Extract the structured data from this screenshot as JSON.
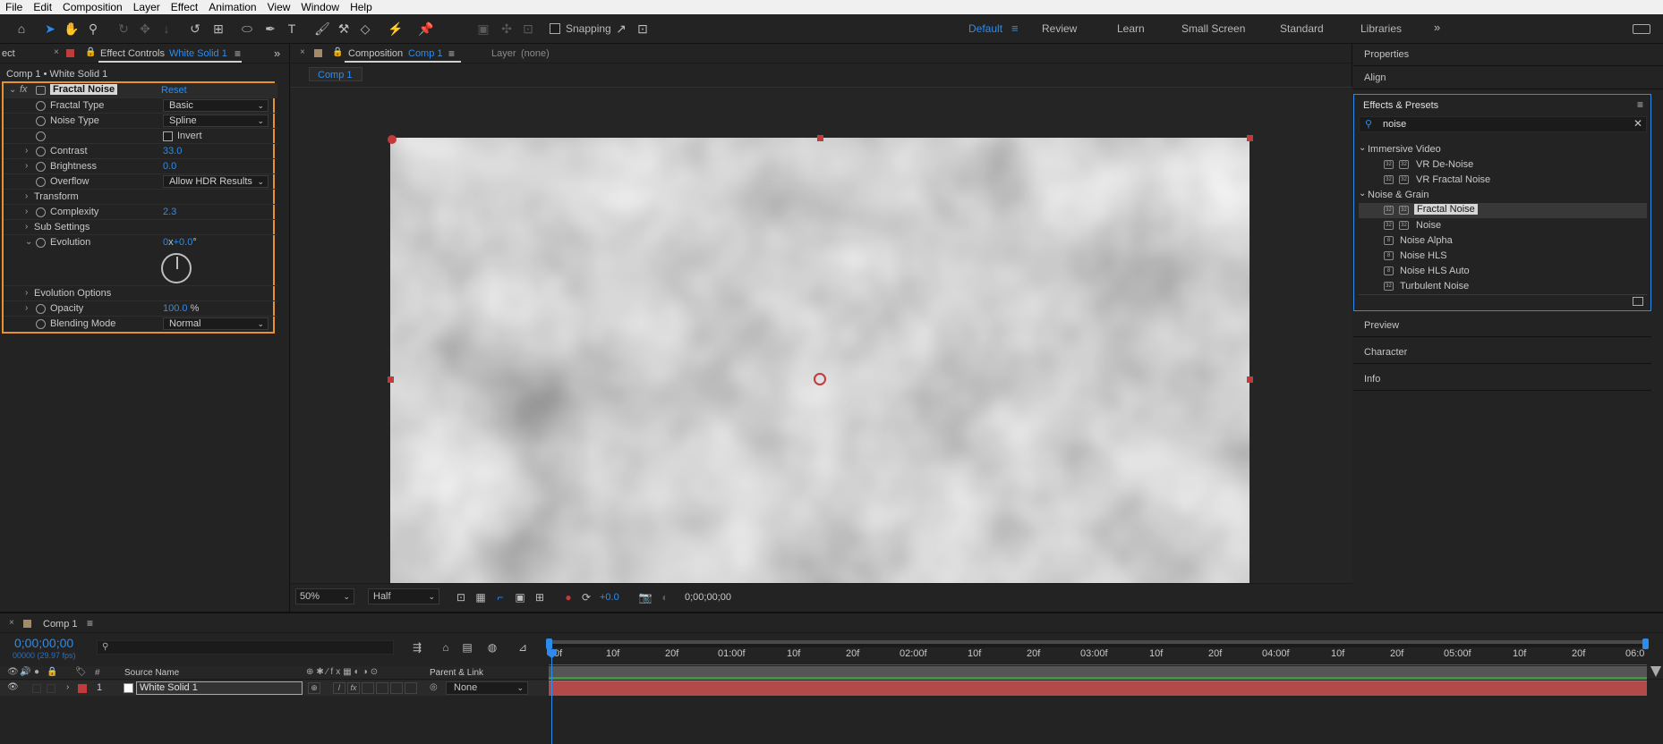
{
  "menubar": [
    "File",
    "Edit",
    "Composition",
    "Layer",
    "Effect",
    "Animation",
    "View",
    "Window",
    "Help"
  ],
  "toolbar": {
    "snapping_label": "Snapping",
    "workspaces": [
      "Default",
      "Review",
      "Learn",
      "Small Screen",
      "Standard",
      "Libraries"
    ],
    "active_workspace": "Default"
  },
  "effect_controls": {
    "tab_partial": "ect",
    "tab_label": "Effect Controls",
    "tab_layer": "White Solid 1",
    "header": "Comp 1 • White Solid 1",
    "effect_name": "Fractal Noise",
    "reset_label": "Reset",
    "props": {
      "fractal_type": {
        "label": "Fractal Type",
        "value": "Basic"
      },
      "noise_type": {
        "label": "Noise Type",
        "value": "Spline"
      },
      "invert": {
        "label": "Invert"
      },
      "contrast": {
        "label": "Contrast",
        "value": "33.0"
      },
      "brightness": {
        "label": "Brightness",
        "value": "0.0"
      },
      "overflow": {
        "label": "Overflow",
        "value": "Allow HDR Results"
      },
      "transform": {
        "label": "Transform"
      },
      "complexity": {
        "label": "Complexity",
        "value": "2.3"
      },
      "sub_settings": {
        "label": "Sub Settings"
      },
      "evolution": {
        "label": "Evolution",
        "rev": "0",
        "x": "x",
        "deg": "+0.0",
        "unit": "°"
      },
      "evolution_options": {
        "label": "Evolution Options"
      },
      "opacity": {
        "label": "Opacity",
        "value": "100.0",
        "unit": "%"
      },
      "blending_mode": {
        "label": "Blending Mode",
        "value": "Normal"
      }
    }
  },
  "composition": {
    "tab_label": "Composition",
    "tab_comp": "Comp 1",
    "layer_label": "Layer",
    "layer_value": "(none)",
    "breadcrumb": "Comp 1",
    "zoom": "50%",
    "resolution": "Half",
    "exposure": "+0.0",
    "timecode": "0;00;00;00"
  },
  "right_panels": {
    "properties": "Properties",
    "align": "Align",
    "effects_presets": "Effects & Presets",
    "search_value": "noise",
    "groups": [
      {
        "name": "Immersive Video",
        "items": [
          "VR De-Noise",
          "VR Fractal Noise"
        ]
      },
      {
        "name": "Noise & Grain",
        "items": [
          "Fractal Noise",
          "Noise",
          "Noise Alpha",
          "Noise HLS",
          "Noise HLS Auto",
          "Turbulent Noise"
        ]
      }
    ],
    "selected_item": "Fractal Noise",
    "preview": "Preview",
    "character": "Character",
    "info": "Info"
  },
  "timeline": {
    "tab_label": "Comp 1",
    "timecode": "0;00;00;00",
    "frame_info": "00000 (29.97 fps)",
    "column_hash": "#",
    "column_source": "Source Name",
    "column_parent": "Parent & Link",
    "layer_number": "1",
    "layer_name": "White Solid 1",
    "parent_value": "None",
    "ticks": [
      "0f",
      "10f",
      "20f",
      "01:00f",
      "10f",
      "20f",
      "02:00f",
      "10f",
      "20f",
      "03:00f",
      "10f",
      "20f",
      "04:00f",
      "10f",
      "20f",
      "05:00f",
      "10f",
      "20f",
      "06:0"
    ]
  },
  "colors": {
    "accent": "#2d8ceb",
    "highlight": "#e8922e",
    "layer_bar": "#b24a4a",
    "label_red": "#c13b3b"
  }
}
